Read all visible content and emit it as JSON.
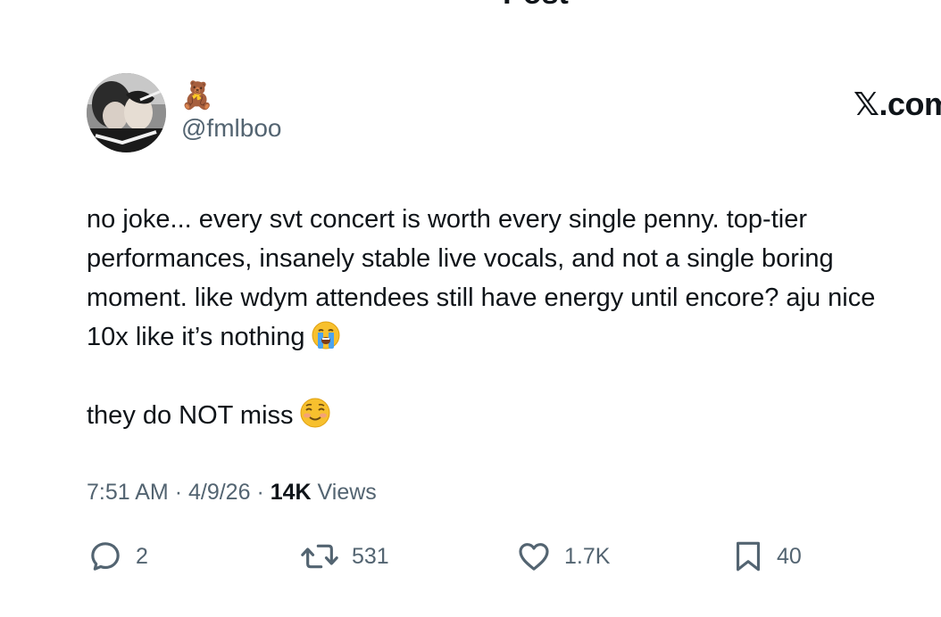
{
  "header": {
    "title": "Post"
  },
  "author": {
    "display_name_emoji": "🧸",
    "handle": "@fmlboo"
  },
  "watermark": {
    "text": "𝕏.com"
  },
  "tweet": {
    "lines": [
      "no joke... every svt concert is worth every single penny. top-tier",
      "performances, insanely stable live vocals, and not a single boring",
      "moment. like wdym attendees still have energy until encore? aju nice",
      "10x like it’s nothing"
    ],
    "line4_emoji": "loudly-crying-face",
    "closing_line": "they do NOT miss",
    "closing_emoji": "smiling-face"
  },
  "meta": {
    "time": "7:51 AM",
    "date": "4/9/26",
    "separator": "·",
    "views_count": "14K",
    "views_label": "Views"
  },
  "actions": {
    "replies": "2",
    "reposts": "531",
    "likes": "1.7K",
    "bookmarks": "40"
  },
  "colors": {
    "text": "#0f1419",
    "secondary": "#536471",
    "background": "#ffffff"
  }
}
